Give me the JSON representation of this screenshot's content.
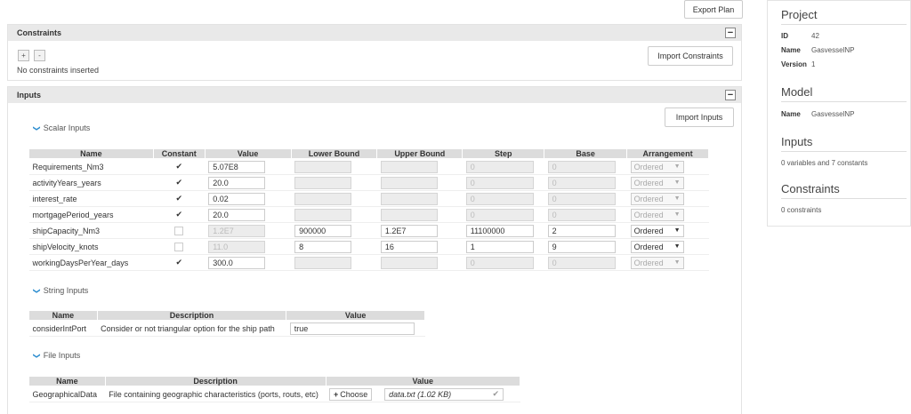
{
  "toolbar": {
    "export_label": "Export Plan"
  },
  "constraints": {
    "title": "Constraints",
    "collapse_symbol": "−",
    "add_label": "+",
    "remove_label": "-",
    "empty_text": "No constraints inserted",
    "import_label": "Import Constraints"
  },
  "inputs": {
    "title": "Inputs",
    "collapse_symbol": "−",
    "import_label": "Import Inputs",
    "scalar_title": "Scalar Inputs",
    "string_title": "String Inputs",
    "file_title": "File Inputs",
    "scalar_headers": [
      "Name",
      "Constant",
      "Value",
      "Lower Bound",
      "Upper Bound",
      "Step",
      "Base",
      "Arrangement"
    ],
    "scalar_rows": [
      {
        "name": "Requirements_Nm3",
        "constant": "✔",
        "value": "5.07E8",
        "lower": "",
        "upper": "",
        "step": "0",
        "base": "0",
        "arrangement": "Ordered"
      },
      {
        "name": "activityYears_years",
        "constant": "✔",
        "value": "20.0",
        "lower": "",
        "upper": "",
        "step": "0",
        "base": "0",
        "arrangement": "Ordered"
      },
      {
        "name": "interest_rate",
        "constant": "✔",
        "value": "0.02",
        "lower": "",
        "upper": "",
        "step": "0",
        "base": "0",
        "arrangement": "Ordered"
      },
      {
        "name": "mortgagePeriod_years",
        "constant": "✔",
        "value": "20.0",
        "lower": "",
        "upper": "",
        "step": "0",
        "base": "0",
        "arrangement": "Ordered"
      },
      {
        "name": "shipCapacity_Nm3",
        "constant": "",
        "value": "1.2E7",
        "lower": "900000",
        "upper": "1.2E7",
        "step": "11100000",
        "base": "2",
        "arrangement": "Ordered"
      },
      {
        "name": "shipVelocity_knots",
        "constant": "",
        "value": "11.0",
        "lower": "8",
        "upper": "16",
        "step": "1",
        "base": "9",
        "arrangement": "Ordered"
      },
      {
        "name": "workingDaysPerYear_days",
        "constant": "✔",
        "value": "300.0",
        "lower": "",
        "upper": "",
        "step": "0",
        "base": "0",
        "arrangement": "Ordered"
      }
    ],
    "string_headers": [
      "Name",
      "Description",
      "Value"
    ],
    "string_rows": [
      {
        "name": "considerIntPort",
        "description": "Consider or not triangular option for the ship path",
        "value": "true"
      }
    ],
    "file_headers": [
      "Name",
      "Description",
      "Value"
    ],
    "file_rows": [
      {
        "name": "GeographicalData",
        "description": "File containing geographic characteristics (ports, routs, etc)",
        "choose_label": "Choose",
        "file_value": "data.txt (1.02 KB)"
      }
    ]
  },
  "sidebar": {
    "project_title": "Project",
    "id_label": "ID",
    "id_value": "42",
    "name_label": "Name",
    "name_value": "GasvesselNP",
    "version_label": "Version",
    "version_value": "1",
    "model_title": "Model",
    "model_name_label": "Name",
    "model_name_value": "GasvesselNP",
    "inputs_title": "Inputs",
    "inputs_summary": "0 variables and 7 constants",
    "constraints_title": "Constraints",
    "constraints_summary": "0 constraints"
  },
  "colors": {
    "accent": "#2b8ccf",
    "header_bg": "#e9e9e9"
  }
}
